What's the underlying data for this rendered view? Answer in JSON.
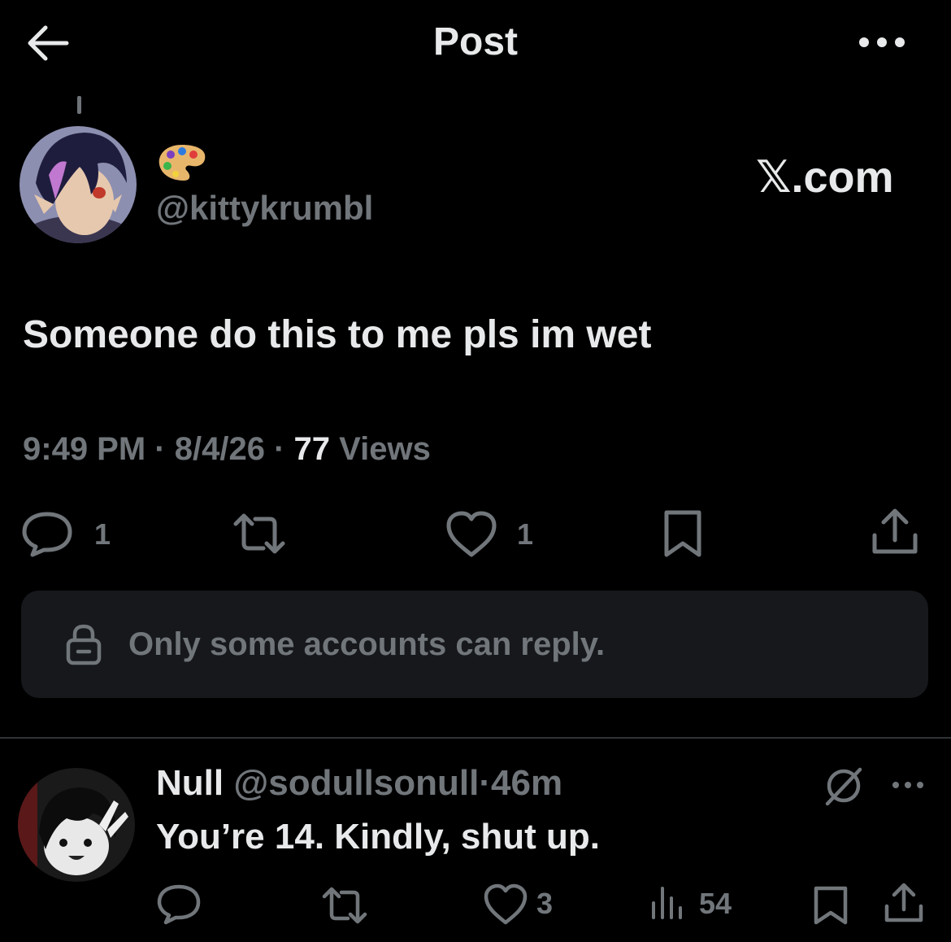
{
  "header": {
    "title": "Post"
  },
  "author": {
    "emoji": "🎨",
    "handle": "@kittykrumbl",
    "watermark": "𝕏.com"
  },
  "post": {
    "text": "Someone do this to me pls im wet",
    "time": "9:49 PM",
    "date": "8/4/26",
    "views_count": "77",
    "views_label": "Views",
    "sep": "·"
  },
  "actions": {
    "reply_count": "1",
    "like_count": "1"
  },
  "restriction": {
    "text": "Only some accounts can reply."
  },
  "reply": {
    "name": "Null",
    "handle": "@sodullsonull",
    "dot": "·",
    "time": "46m",
    "text": "You’re 14. Kindly, shut up.",
    "like_count": "3",
    "views_count": "54"
  },
  "colors": {
    "background": "#000000",
    "text_primary": "#e7e9ea",
    "text_secondary": "#71767b",
    "panel": "#16181c",
    "divider": "#2f3336"
  },
  "icons": [
    "back-arrow-icon",
    "more-icon",
    "palette-icon",
    "reply-icon",
    "retweet-icon",
    "like-icon",
    "bookmark-icon",
    "share-icon",
    "lock-icon",
    "grok-icon",
    "views-icon"
  ]
}
